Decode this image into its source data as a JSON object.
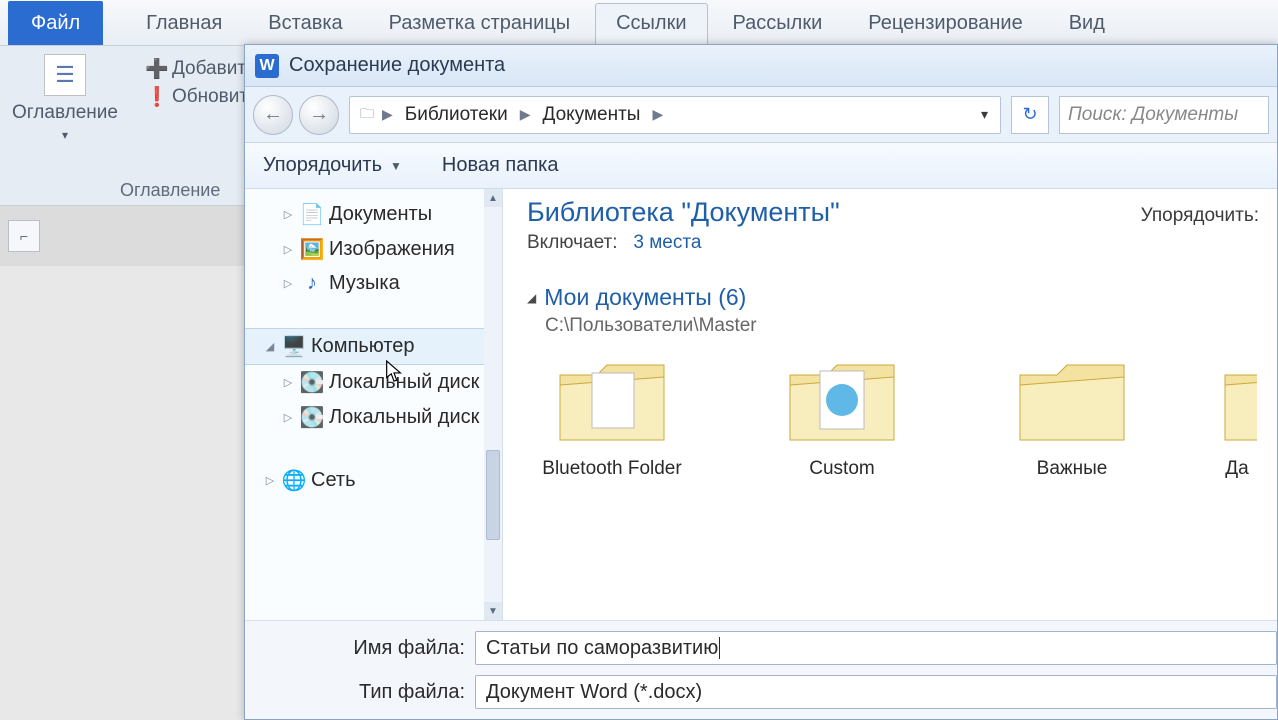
{
  "word": {
    "tabs": {
      "file": "Файл",
      "home": "Главная",
      "insert": "Вставка",
      "layout": "Разметка страницы",
      "references": "Ссылки",
      "mail": "Рассылки",
      "review": "Рецензирование",
      "view": "Вид"
    },
    "ribbon": {
      "toc_label": "Оглавление",
      "add_text": "Добавить текст",
      "update_toc": "Обновить таблицу",
      "group_label": "Оглавление"
    }
  },
  "dialog": {
    "title": "Сохранение документа",
    "breadcrumb": {
      "root": "Библиотеки",
      "current": "Документы"
    },
    "search_placeholder": "Поиск: Документы",
    "toolbar": {
      "organize": "Упорядочить",
      "new_folder": "Новая папка"
    },
    "tree": {
      "items": [
        {
          "expand": "▷",
          "icon": "doc",
          "label": "Документы"
        },
        {
          "expand": "▷",
          "icon": "img",
          "label": "Изображения"
        },
        {
          "expand": "▷",
          "icon": "music",
          "label": "Музыка"
        }
      ],
      "computer": {
        "expand": "◢",
        "label": "Компьютер"
      },
      "drives": [
        {
          "expand": "▷",
          "label": "Локальный диск"
        },
        {
          "expand": "▷",
          "label": "Локальный диск"
        }
      ],
      "network": {
        "expand": "▷",
        "label": "Сеть"
      }
    },
    "content": {
      "lib_title": "Библиотека \"Документы\"",
      "includes_label": "Включает:",
      "includes_link": "3 места",
      "sort_label": "Упорядочить:",
      "section_title": "Мои документы (6)",
      "section_path": "C:\\Пользователи\\Master",
      "folders": [
        {
          "name": "Bluetooth Folder"
        },
        {
          "name": "Custom"
        },
        {
          "name": "Важные"
        },
        {
          "name": "Да"
        }
      ]
    },
    "fields": {
      "name_label": "Имя файла:",
      "name_value": "Статьи по саморазвитию",
      "type_label": "Тип файла:",
      "type_value": "Документ Word (*.docx)"
    }
  }
}
